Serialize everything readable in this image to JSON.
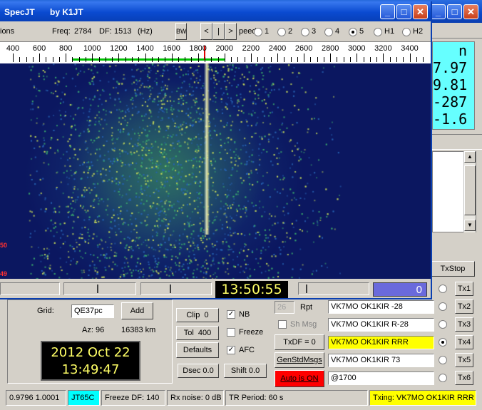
{
  "main": {
    "side_values": [
      "n",
      "7.97",
      "9.81",
      "-287",
      "-1.6"
    ],
    "grid_label": "Grid:",
    "grid_value": "QE37pc",
    "add_label": "Add",
    "az": "Az: 96",
    "distance": "16383 km",
    "date": "2012 Oct 22",
    "time": "13:49:47",
    "clip_label": "Clip",
    "clip_value": "0",
    "tol_label": "Tol",
    "tol_value": "400",
    "defaults_label": "Defaults",
    "dsec_label": "Dsec",
    "dsec_value": "0.0",
    "shift_label": "Shift",
    "shift_value": "0.0",
    "nb_label": "NB",
    "freeze_label": "Freeze",
    "afc_label": "AFC",
    "rpt_value": "26",
    "rpt_label": "Rpt",
    "sh_msg_label": "Sh Msg",
    "txdf_label": "TxDF = 0",
    "gen_std_label": "GenStdMsgs",
    "auto_label": "Auto is ON",
    "txstop_label": "TxStop",
    "messages": [
      "VK7MO OK1KIR -28",
      "VK7MO OK1KIR R-28",
      "VK7MO OK1KIR RRR",
      "VK7MO OK1KIR 73",
      "@1700"
    ],
    "tx_buttons": [
      "Tx1",
      "Tx2",
      "Tx3",
      "Tx4",
      "Tx5",
      "Tx6"
    ],
    "status": {
      "ratio": "0.9796 1.0001",
      "mode": "JT65C",
      "freeze_df": "Freeze DF: 140",
      "rx_noise": "Rx noise:  0 dB",
      "tr_period": "TR Period: 60 s",
      "txing": "Txing:  VK7MO OK1KIR RRR"
    }
  },
  "spec": {
    "title_app": "SpecJT",
    "title_by": "by K1JT",
    "menu_options": "ions",
    "freq_label": "Freq:",
    "freq_value": "2784",
    "df_label": "DF:",
    "df_value": "1513",
    "df_unit": "(Hz)",
    "bw_label": "BW",
    "nav_left": "<",
    "nav_mid": "|",
    "nav_right": ">",
    "speed_label": "peed",
    "speed_options": [
      "1",
      "2",
      "3",
      "4",
      "5",
      "H1",
      "H2"
    ],
    "ruler_labels": [
      "400",
      "600",
      "800",
      "1000",
      "1200",
      "1400",
      "1600",
      "1800",
      "2000",
      "2200",
      "2400",
      "2600",
      "2800",
      "3000",
      "3200",
      "3400"
    ],
    "left_marker_1": "50",
    "left_marker_2": "49",
    "clock": "13:50:55",
    "counter": "0"
  },
  "colors": {
    "cyan": "#66ffff",
    "clock_bg": "#000000",
    "clock_fg": "#ffff66",
    "yellow": "#ffff00",
    "auto_red": "#ff0000",
    "mode_cyan": "#00ffff",
    "counter_bg": "#6a6adc"
  }
}
